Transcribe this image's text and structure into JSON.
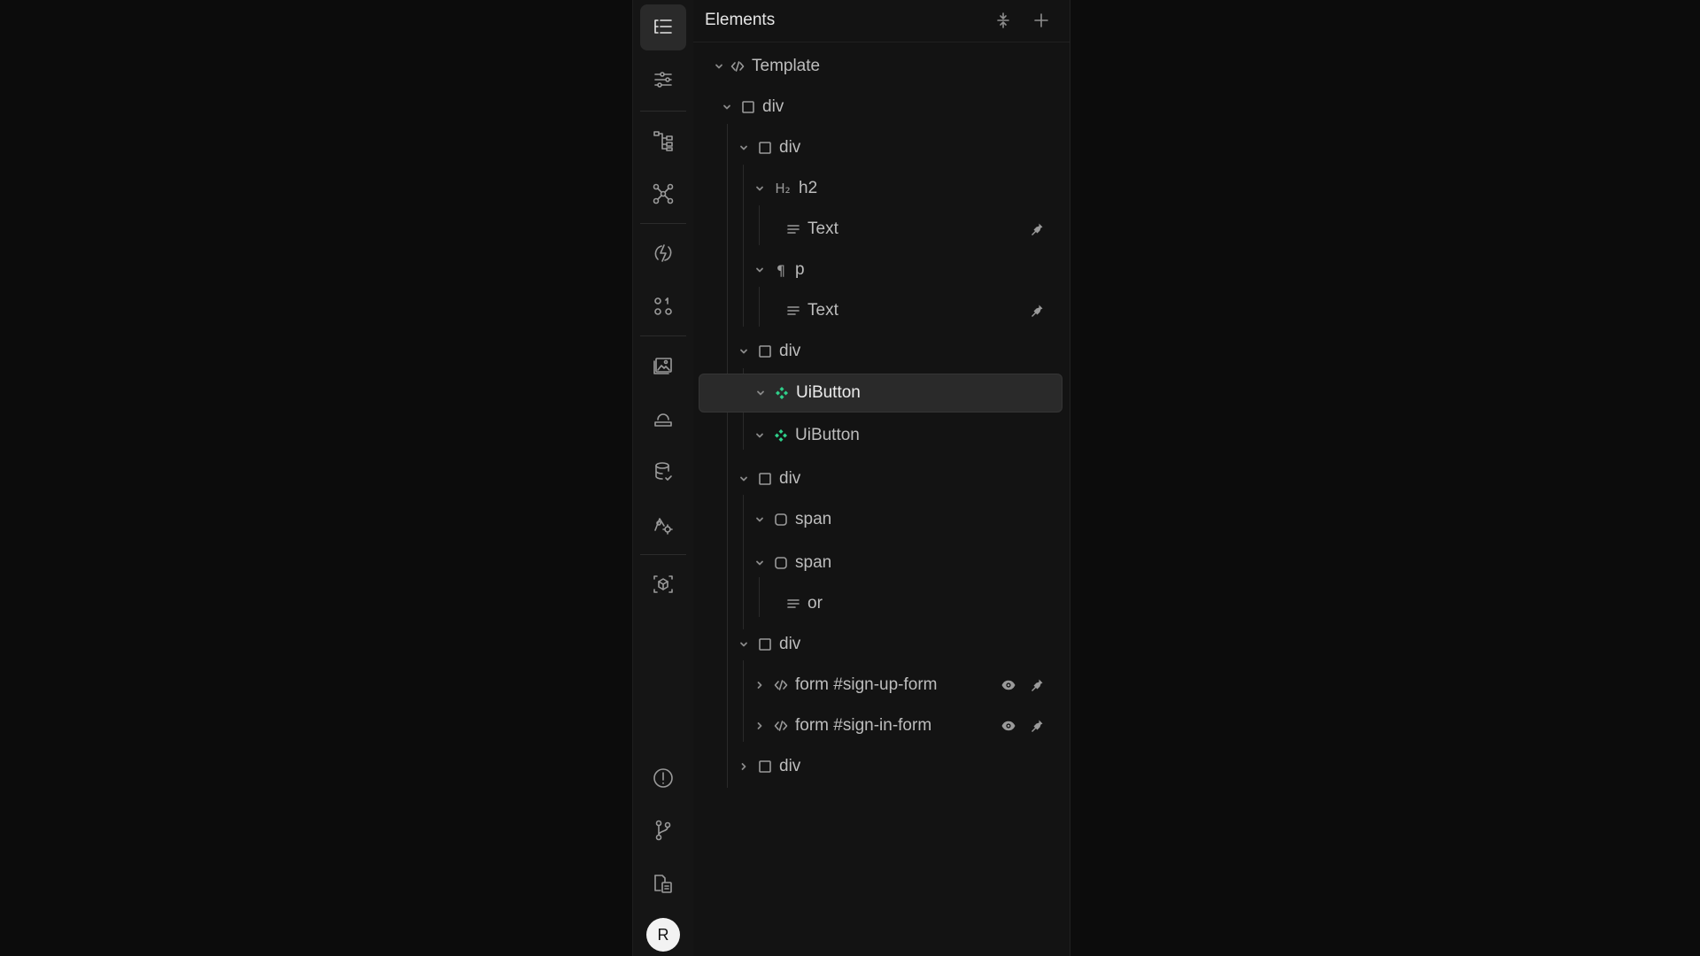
{
  "panel": {
    "title": "Elements"
  },
  "tree": [
    {
      "label": "Template",
      "icon": "code-icon"
    },
    {
      "label": "div",
      "icon": "square-icon"
    },
    {
      "label": "div",
      "icon": "square-icon"
    },
    {
      "label": "h2",
      "icon": "h2-icon",
      "glyph": "H₂"
    },
    {
      "label": "Text",
      "icon": "text-lines-icon"
    },
    {
      "label": "p",
      "icon": "paragraph-icon",
      "glyph": "¶"
    },
    {
      "label": "Text",
      "icon": "text-lines-icon"
    },
    {
      "label": "div",
      "icon": "square-icon"
    },
    {
      "label": "UiButton",
      "icon": "component-icon"
    },
    {
      "label": "UiButton",
      "icon": "component-icon"
    },
    {
      "label": "div",
      "icon": "square-icon"
    },
    {
      "label": "span",
      "icon": "rounded-square-icon"
    },
    {
      "label": "span",
      "icon": "rounded-square-icon"
    },
    {
      "label": "or",
      "icon": "text-lines-icon"
    },
    {
      "label": "div",
      "icon": "square-icon"
    },
    {
      "label": "form #sign-up-form",
      "icon": "code-icon"
    },
    {
      "label": "form #sign-in-form",
      "icon": "code-icon"
    },
    {
      "label": "div",
      "icon": "square-icon"
    }
  ],
  "user": {
    "avatar_initial": "R"
  },
  "colors": {
    "accent_component": "#2fd08a",
    "background": "#0c0c0c",
    "panel": "#131313",
    "selected_row": "#2a2a2a"
  }
}
